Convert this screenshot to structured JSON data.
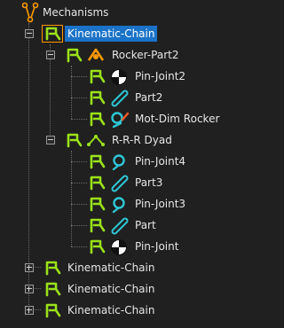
{
  "tree": {
    "root": {
      "label": "Mechanisms",
      "icon": "mechanisms-icon"
    },
    "chain1": {
      "label": "Kinematic-Chain",
      "rocker": {
        "label": "Rocker-Part2",
        "children": [
          "Pin-Joint2",
          "Part2",
          "Mot-Dim Rocker"
        ]
      },
      "dyad": {
        "label": "R-R-R Dyad",
        "children": [
          "Pin-Joint4",
          "Part3",
          "Pin-Joint3",
          "Part",
          "Pin-Joint"
        ]
      }
    },
    "collapsed_chains": [
      "Kinematic-Chain",
      "Kinematic-Chain",
      "Kinematic-Chain"
    ]
  },
  "colors": {
    "accent_green": "#9be21a",
    "selection_blue": "#1a73c8",
    "orange": "#ff9900",
    "cyan": "#2ec6d6"
  }
}
